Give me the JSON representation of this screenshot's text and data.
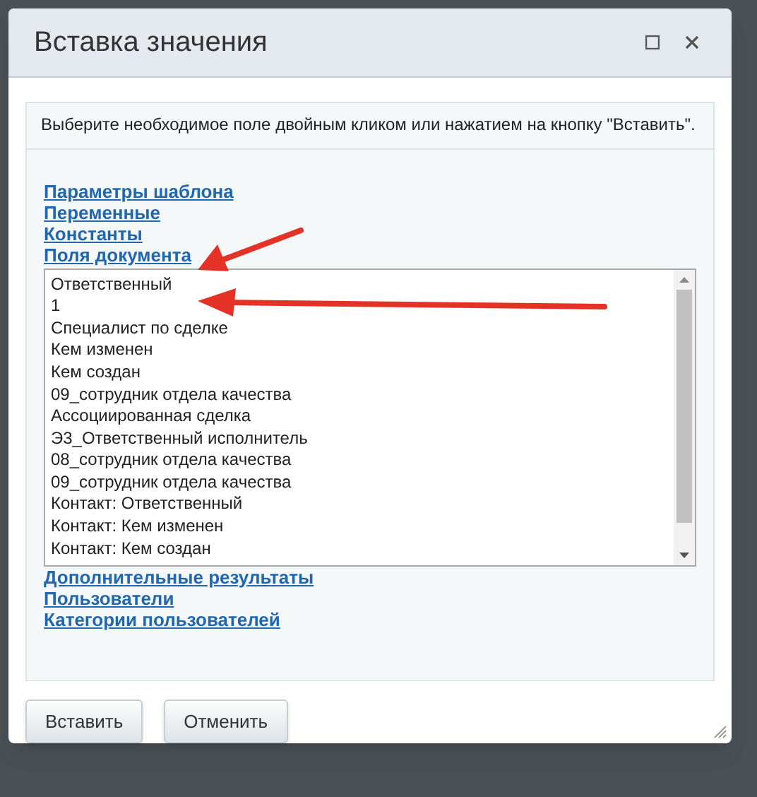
{
  "dialog": {
    "title": "Вставка значения"
  },
  "hint": "Выберите необходимое поле двойным кликом или нажатием на кнопку \"Вставить\".",
  "groups_before": [
    "Параметры шаблона",
    "Переменные",
    "Константы",
    "Поля документа"
  ],
  "fields": [
    {
      "label": "Ответственный",
      "selected": false
    },
    {
      "label": "1",
      "selected": false
    },
    {
      "label": "Специалист по сделке",
      "selected": false
    },
    {
      "label": "Кем изменен",
      "selected": false
    },
    {
      "label": "Кем создан",
      "selected": false
    },
    {
      "label": "09_сотрудник отдела качества",
      "selected": false
    },
    {
      "label": "Ассоциированная сделка",
      "selected": false
    },
    {
      "label": "Э3_Ответственный исполнитель",
      "selected": false
    },
    {
      "label": "08_сотрудник отдела качества",
      "selected": false
    },
    {
      "label": "09_сотрудник отдела качества",
      "selected": false
    },
    {
      "label": "Контакт: Ответственный",
      "selected": false
    },
    {
      "label": "Контакт: Кем изменен",
      "selected": false
    },
    {
      "label": "Контакт: Кем создан",
      "selected": false
    }
  ],
  "groups_after": [
    "Дополнительные результаты",
    "Пользователи",
    "Категории пользователей"
  ],
  "buttons": [
    "Вставить",
    "Отменить"
  ]
}
